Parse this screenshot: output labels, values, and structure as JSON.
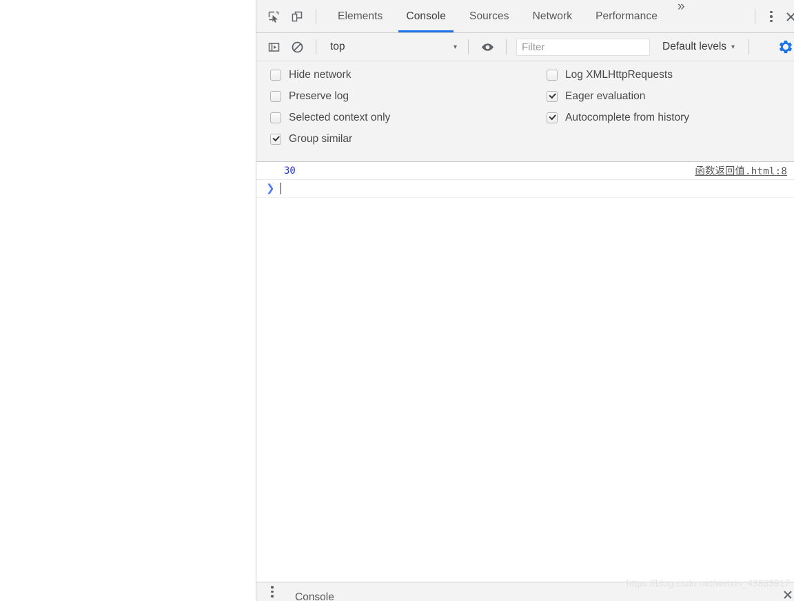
{
  "panel": {
    "toolbar": {
      "inspect_icon": "inspect-cursor-icon",
      "device_toolbar_icon": "device-toolbar-icon",
      "overflow_label": "»",
      "main_menu_icon": "kebab-menu-icon",
      "close_icon": "close-icon"
    },
    "tabs": [
      {
        "label": "Elements",
        "selected": false
      },
      {
        "label": "Console",
        "selected": true
      },
      {
        "label": "Sources",
        "selected": false
      },
      {
        "label": "Network",
        "selected": false
      },
      {
        "label": "Performance",
        "selected": false
      }
    ],
    "filterbar": {
      "sidebar_toggle_icon": "console-sidebar-icon",
      "clear_console_icon": "clear-console-icon",
      "context_value": "top",
      "context_caret": "▾",
      "live_expression_icon": "eye-icon",
      "filter_placeholder": "Filter",
      "filter_value": "",
      "levels_label": "Default levels",
      "levels_caret": "▾",
      "settings_icon": "gear-icon",
      "settings_color": "#1a73e8"
    },
    "preferences": {
      "left": [
        {
          "label": "Hide network",
          "checked": false
        },
        {
          "label": "Preserve log",
          "checked": false
        },
        {
          "label": "Selected context only",
          "checked": false
        },
        {
          "label": "Group similar",
          "checked": true
        }
      ],
      "right": [
        {
          "label": "Log XMLHttpRequests",
          "checked": false
        },
        {
          "label": "Eager evaluation",
          "checked": true
        },
        {
          "label": "Autocomplete from history",
          "checked": true
        }
      ]
    },
    "console": {
      "entries": [
        {
          "value": "30",
          "source": "函数返回值.html:8"
        }
      ],
      "prompt_arrow": "❯"
    },
    "drawer": {
      "menu_icon": "kebab-menu-icon",
      "tab_label": "Console",
      "close_icon": "close-icon"
    }
  },
  "watermark": "https://blog.csdn.net/weixin_43883917",
  "theme": {
    "chrome_bg": "#f3f3f3",
    "accent": "#1a73e8",
    "text": "#5a5a5a",
    "value_blue": "#222fd4"
  }
}
